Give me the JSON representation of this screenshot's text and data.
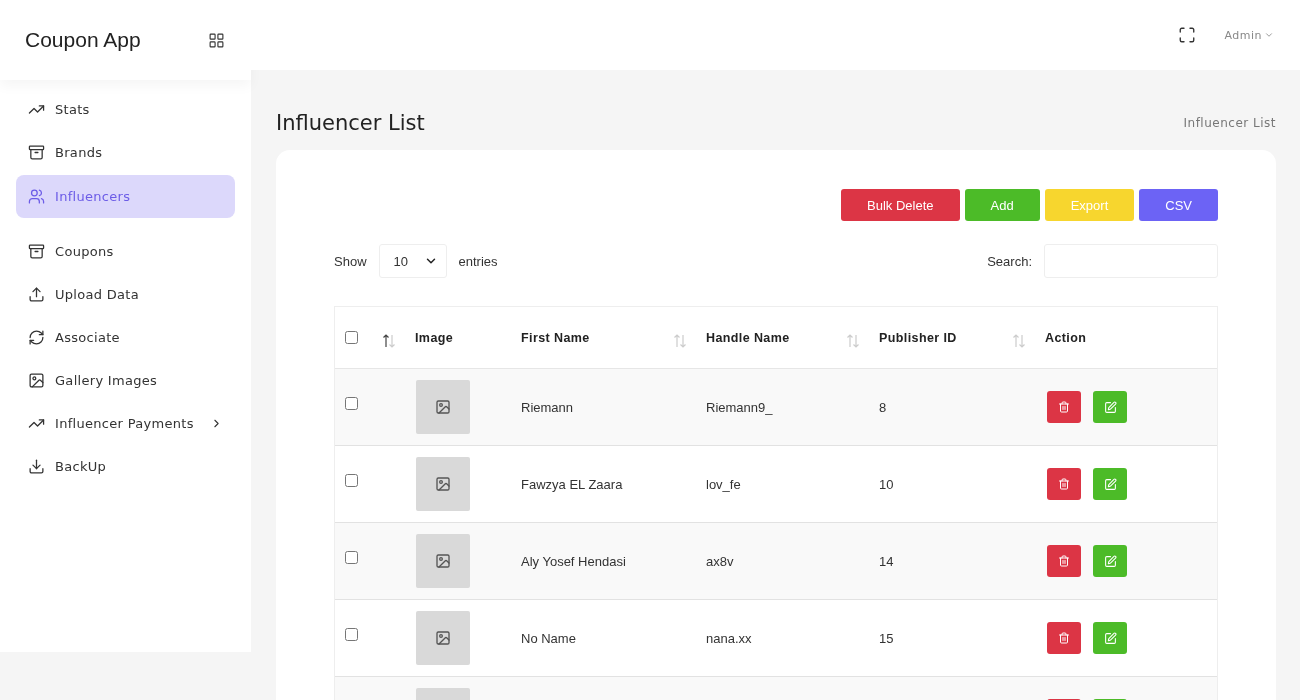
{
  "sidebar": {
    "brand": "Coupon App",
    "items": [
      {
        "label": "Stats",
        "selected": false,
        "expandable": false
      },
      {
        "label": "Brands",
        "selected": false,
        "expandable": false
      },
      {
        "label": "Influencers",
        "selected": true,
        "expandable": false
      },
      {
        "label": "Coupons",
        "selected": false,
        "expandable": false
      },
      {
        "label": "Upload Data",
        "selected": false,
        "expandable": false
      },
      {
        "label": "Associate",
        "selected": false,
        "expandable": false
      },
      {
        "label": "Gallery Images",
        "selected": false,
        "expandable": false
      },
      {
        "label": "Influencer Payments",
        "selected": false,
        "expandable": true
      },
      {
        "label": "BackUp",
        "selected": false,
        "expandable": false
      }
    ]
  },
  "header": {
    "user": "Admin"
  },
  "page": {
    "title": "Influencer List",
    "breadcrumb": "Influencer List"
  },
  "actions": [
    {
      "label": "Bulk Delete",
      "color": "#dc3545"
    },
    {
      "label": "Add",
      "color": "#4cbb28"
    },
    {
      "label": "Export",
      "color": "#f7d62e"
    },
    {
      "label": "CSV",
      "color": "#6c63f5"
    }
  ],
  "length": {
    "before": "Show",
    "value": "10",
    "after": "entries"
  },
  "search": {
    "label": "Search:"
  },
  "table": {
    "select_all": {
      "checked": false,
      "sortable": true,
      "sorted": true
    },
    "columns": [
      {
        "label": "Image",
        "sortable": false
      },
      {
        "label": "First Name",
        "sortable": true
      },
      {
        "label": "Handle Name",
        "sortable": true
      },
      {
        "label": "Publisher ID",
        "sortable": true
      },
      {
        "label": "Action",
        "sortable": false
      }
    ],
    "rows": [
      {
        "checked": false,
        "first_name": "Riemann",
        "handle": "Riemann9_",
        "publisher_id": "8"
      },
      {
        "checked": false,
        "first_name": "Fawzya EL Zaara",
        "handle": "lov_fe",
        "publisher_id": "10"
      },
      {
        "checked": false,
        "first_name": "Aly Yosef Hendasi",
        "handle": "ax8v",
        "publisher_id": "14"
      },
      {
        "checked": false,
        "first_name": "No Name",
        "handle": "nana.xx",
        "publisher_id": "15"
      }
    ]
  }
}
